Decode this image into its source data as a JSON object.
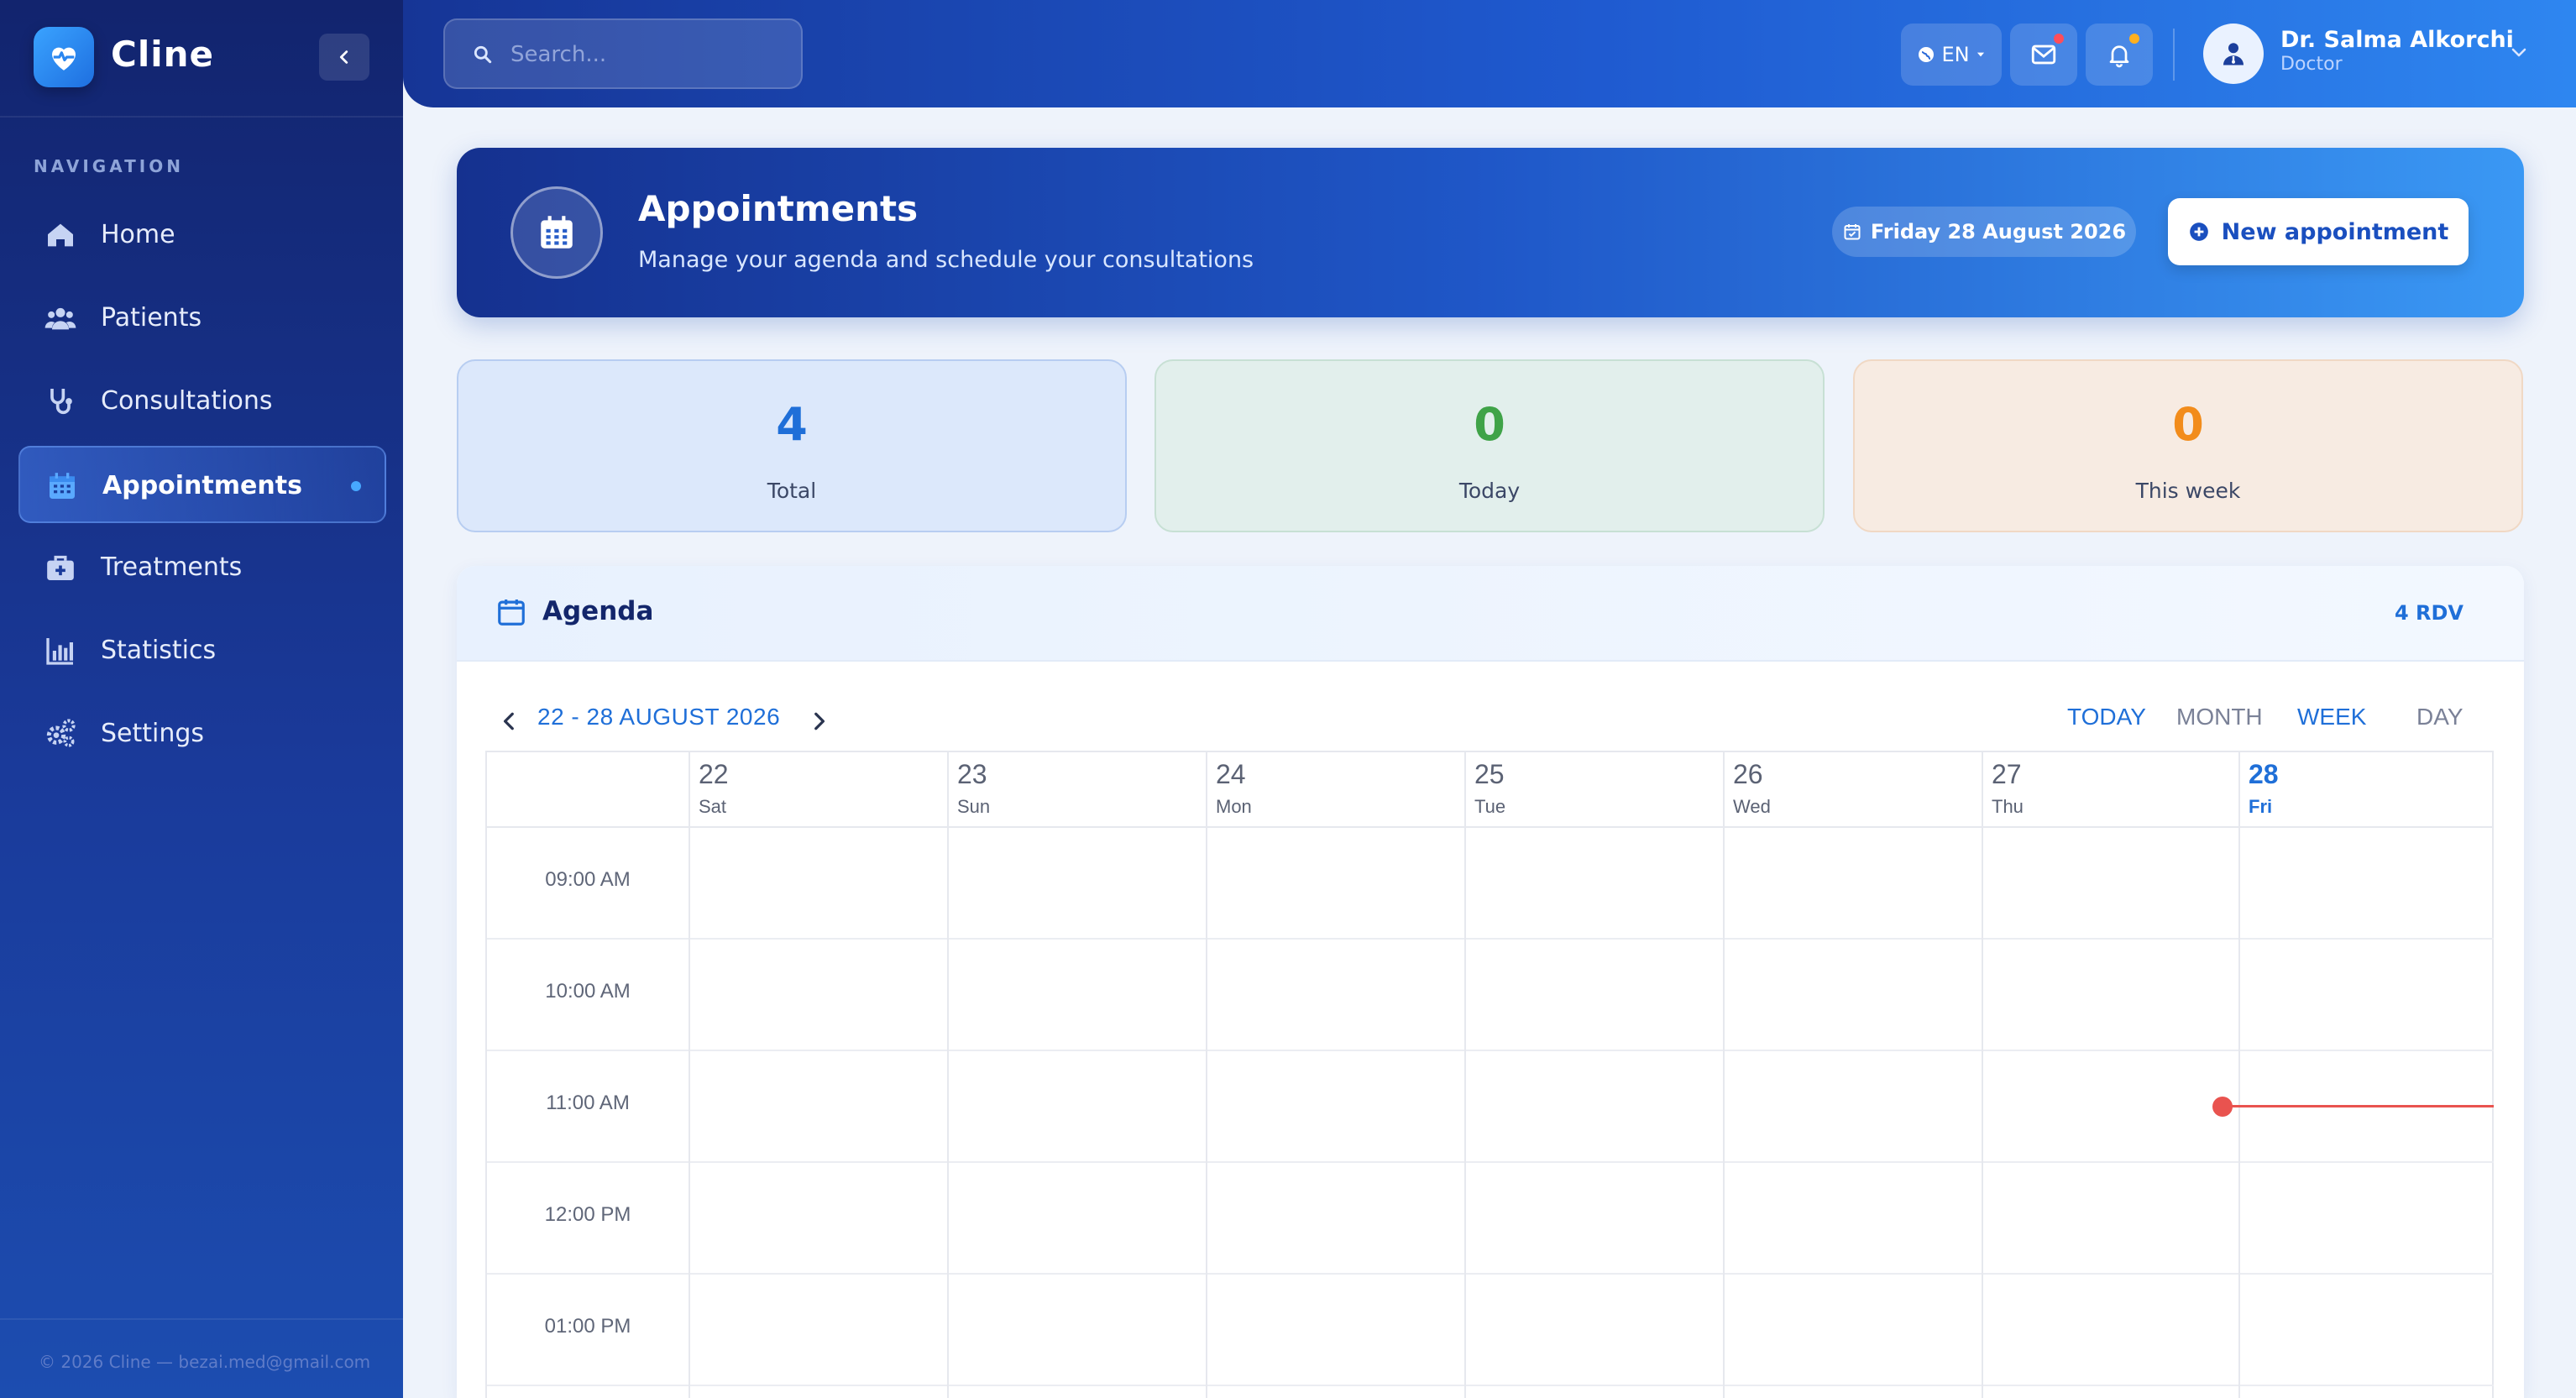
{
  "brand": {
    "name": "Cline"
  },
  "sidebar": {
    "heading": "NAVIGATION",
    "items": [
      {
        "label": "Home",
        "icon": "home-icon",
        "active": false
      },
      {
        "label": "Patients",
        "icon": "users-icon",
        "active": false
      },
      {
        "label": "Consultations",
        "icon": "stethoscope-icon",
        "active": false
      },
      {
        "label": "Appointments",
        "icon": "calendar-icon",
        "active": true
      },
      {
        "label": "Treatments",
        "icon": "medkit-icon",
        "active": false
      },
      {
        "label": "Statistics",
        "icon": "bar-chart-icon",
        "active": false
      },
      {
        "label": "Settings",
        "icon": "gears-icon",
        "active": false
      }
    ],
    "footer": "© 2026 Cline — bezai.med@gmail.com"
  },
  "topbar": {
    "search_placeholder": "Search...",
    "language": "EN",
    "mail_badge_color": "#ff4d5a",
    "bell_badge_color": "#ffb020",
    "user": {
      "name": "Dr. Salma Alkorchi",
      "role": "Doctor"
    }
  },
  "hero": {
    "title": "Appointments",
    "subtitle": "Manage your agenda and schedule your consultations",
    "date": "Friday 28 August 2026",
    "new_button": "New appointment"
  },
  "stats": {
    "total": {
      "value": "4",
      "label": "Total",
      "color": "#1f6fd8"
    },
    "today": {
      "value": "0",
      "label": "Today",
      "color": "#3fa348"
    },
    "week": {
      "value": "0",
      "label": "This week",
      "color": "#f28c1b"
    }
  },
  "agenda": {
    "title": "Agenda",
    "count": "4 RDV",
    "range": "22 - 28 AUGUST 2026",
    "views": {
      "today": "TODAY",
      "month": "MONTH",
      "week": "WEEK",
      "day": "DAY"
    },
    "days": [
      {
        "num": "22",
        "name": "Sat"
      },
      {
        "num": "23",
        "name": "Sun"
      },
      {
        "num": "24",
        "name": "Mon"
      },
      {
        "num": "25",
        "name": "Tue"
      },
      {
        "num": "26",
        "name": "Wed"
      },
      {
        "num": "27",
        "name": "Thu"
      },
      {
        "num": "28",
        "name": "Fri"
      }
    ],
    "times": [
      "09:00 AM",
      "10:00 AM",
      "11:00 AM",
      "12:00 PM",
      "01:00 PM"
    ]
  }
}
